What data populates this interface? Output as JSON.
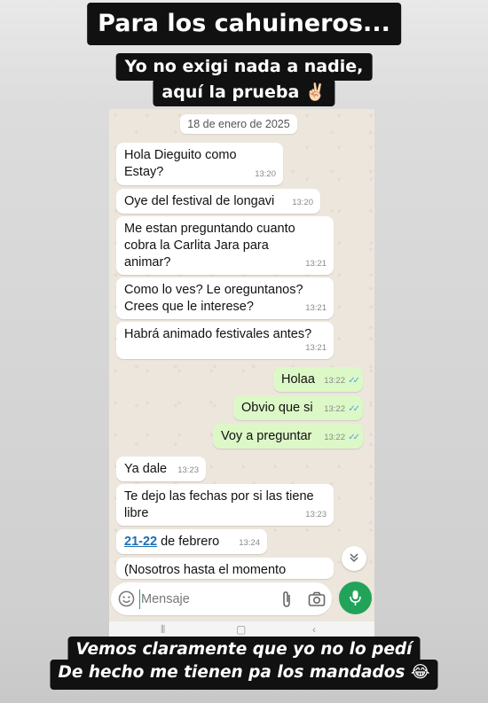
{
  "story": {
    "title": "Para los cahuineros...",
    "subtitle_line1": "Yo no exigi nada a nadie,",
    "subtitle_line2": "aquí la prueba",
    "subtitle_emoji": "✌🏻",
    "footer_line1": "Vemos claramente que yo no lo pedí",
    "footer_line2": "De hecho me tienen pa los mandados",
    "footer_emoji": "😂"
  },
  "chat": {
    "date": "18 de enero de 2025",
    "messages": [
      {
        "dir": "in",
        "text": "Hola Dieguito como Estay?",
        "time": "13:20"
      },
      {
        "dir": "in",
        "text": "Oye del festival de longavi",
        "time": "13:20"
      },
      {
        "dir": "in",
        "text": "Me estan preguntando cuanto cobra la Carlita Jara para animar?",
        "time": "13:21"
      },
      {
        "dir": "in",
        "text": "Como lo ves? Le oreguntanos? Crees que le interese?",
        "time": "13:21"
      },
      {
        "dir": "in",
        "text": "Habrá animado festivales antes?",
        "time": "13:21"
      },
      {
        "dir": "out",
        "text": "Holaa",
        "time": "13:22"
      },
      {
        "dir": "out",
        "text": "Obvio que si",
        "time": "13:22"
      },
      {
        "dir": "out",
        "text": "Voy a preguntar",
        "time": "13:22"
      },
      {
        "dir": "in",
        "text": "Ya dale",
        "time": "13:23"
      },
      {
        "dir": "in",
        "text": "Te dejo las fechas por si las tiene libre",
        "time": "13:23"
      },
      {
        "dir": "in",
        "link": "21-22",
        "text": " de febrero",
        "time": "13:24"
      },
      {
        "dir": "in",
        "text": "(Nosotros hasta el momento",
        "time": ""
      }
    ],
    "input_placeholder": "Mensaje",
    "icons": {
      "emoji": "emoji-icon",
      "attach": "paperclip-icon",
      "camera": "camera-icon",
      "mic": "microphone-icon",
      "scroll": "double-chevron-down-icon"
    },
    "colors": {
      "incoming": "#ffffff",
      "outgoing": "#dcf8c6",
      "mic": "#22a35a",
      "ticks": "#4fa3e0"
    }
  }
}
